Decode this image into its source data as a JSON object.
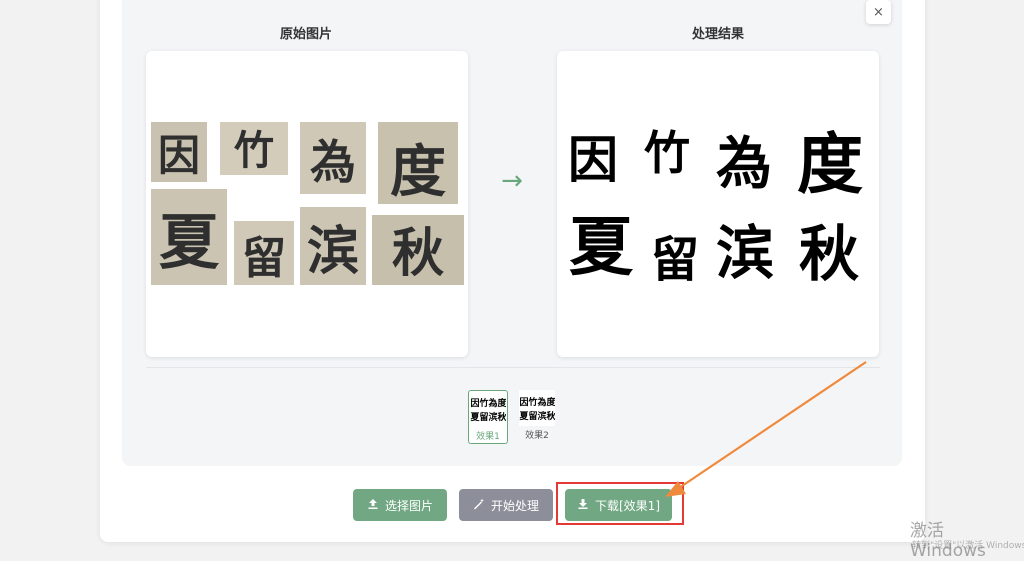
{
  "panels": {
    "original_title": "原始图片",
    "result_title": "处理结果"
  },
  "close_icon": "×",
  "arrow_glyph": "→",
  "characters": [
    "因",
    "竹",
    "為",
    "度",
    "夏",
    "留",
    "滨",
    "秋"
  ],
  "thumbnails": [
    {
      "label": "效果1",
      "active": true
    },
    {
      "label": "效果2",
      "active": false
    }
  ],
  "buttons": {
    "select": "选择图片",
    "process": "开始处理",
    "download": "下载[效果1]"
  },
  "icons": {
    "select": "upload-icon",
    "process": "magic-wand-icon",
    "download": "download-icon"
  },
  "colors": {
    "accent": "#71a883",
    "secondary": "#8c8f99",
    "highlight": "#e53935",
    "annotation_arrow": "#ef8a3c"
  },
  "watermark": {
    "title": "激活 Windows",
    "subtitle": "转到\"设置\"以激活 Windows。"
  }
}
